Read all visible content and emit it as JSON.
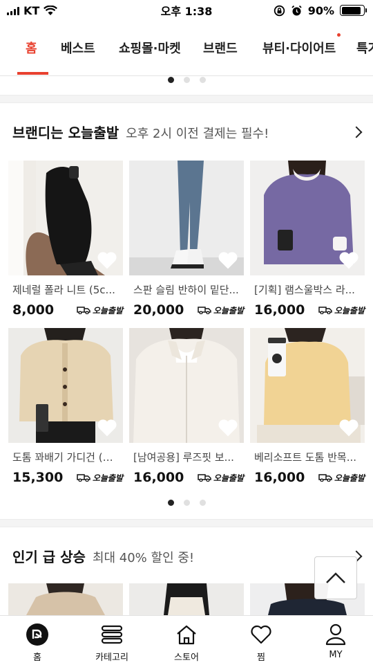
{
  "status_bar": {
    "carrier": "KT",
    "time": "오후 1:38",
    "battery": "90%"
  },
  "tabs": [
    "홈",
    "베스트",
    "쇼핑몰·마켓",
    "브랜드",
    "뷰티·다이어트",
    "특가"
  ],
  "section1": {
    "title": "브랜디는 오늘출발",
    "subtitle": "오후 2시 이전 결제는 필수!",
    "products": [
      {
        "name": "제네럴 폴라 니트 (5c...",
        "price": "8,000",
        "badge": "오늘출발"
      },
      {
        "name": "스판 슬림 반하이 밑단...",
        "price": "20,000",
        "badge": "오늘출발"
      },
      {
        "name": "[기획] 램스울박스 라...",
        "price": "16,000",
        "badge": "오늘출발"
      },
      {
        "name": "도톰 꽈배기 가디건 (3...",
        "price": "15,300",
        "badge": "오늘출발"
      },
      {
        "name": "[남여공용] 루즈핏 보...",
        "price": "16,000",
        "badge": "오늘출발"
      },
      {
        "name": "베리소프트 도톰 반목...",
        "price": "16,000",
        "badge": "오늘출발"
      }
    ]
  },
  "section2": {
    "title": "인기 급 상승",
    "subtitle": "최대 40% 할인 중!"
  },
  "bottom_nav": [
    "홈",
    "카테고리",
    "스토어",
    "찜",
    "MY"
  ],
  "colors": {
    "accent": "#e8412f",
    "text": "#222222",
    "divider": "#f4f4f4"
  }
}
